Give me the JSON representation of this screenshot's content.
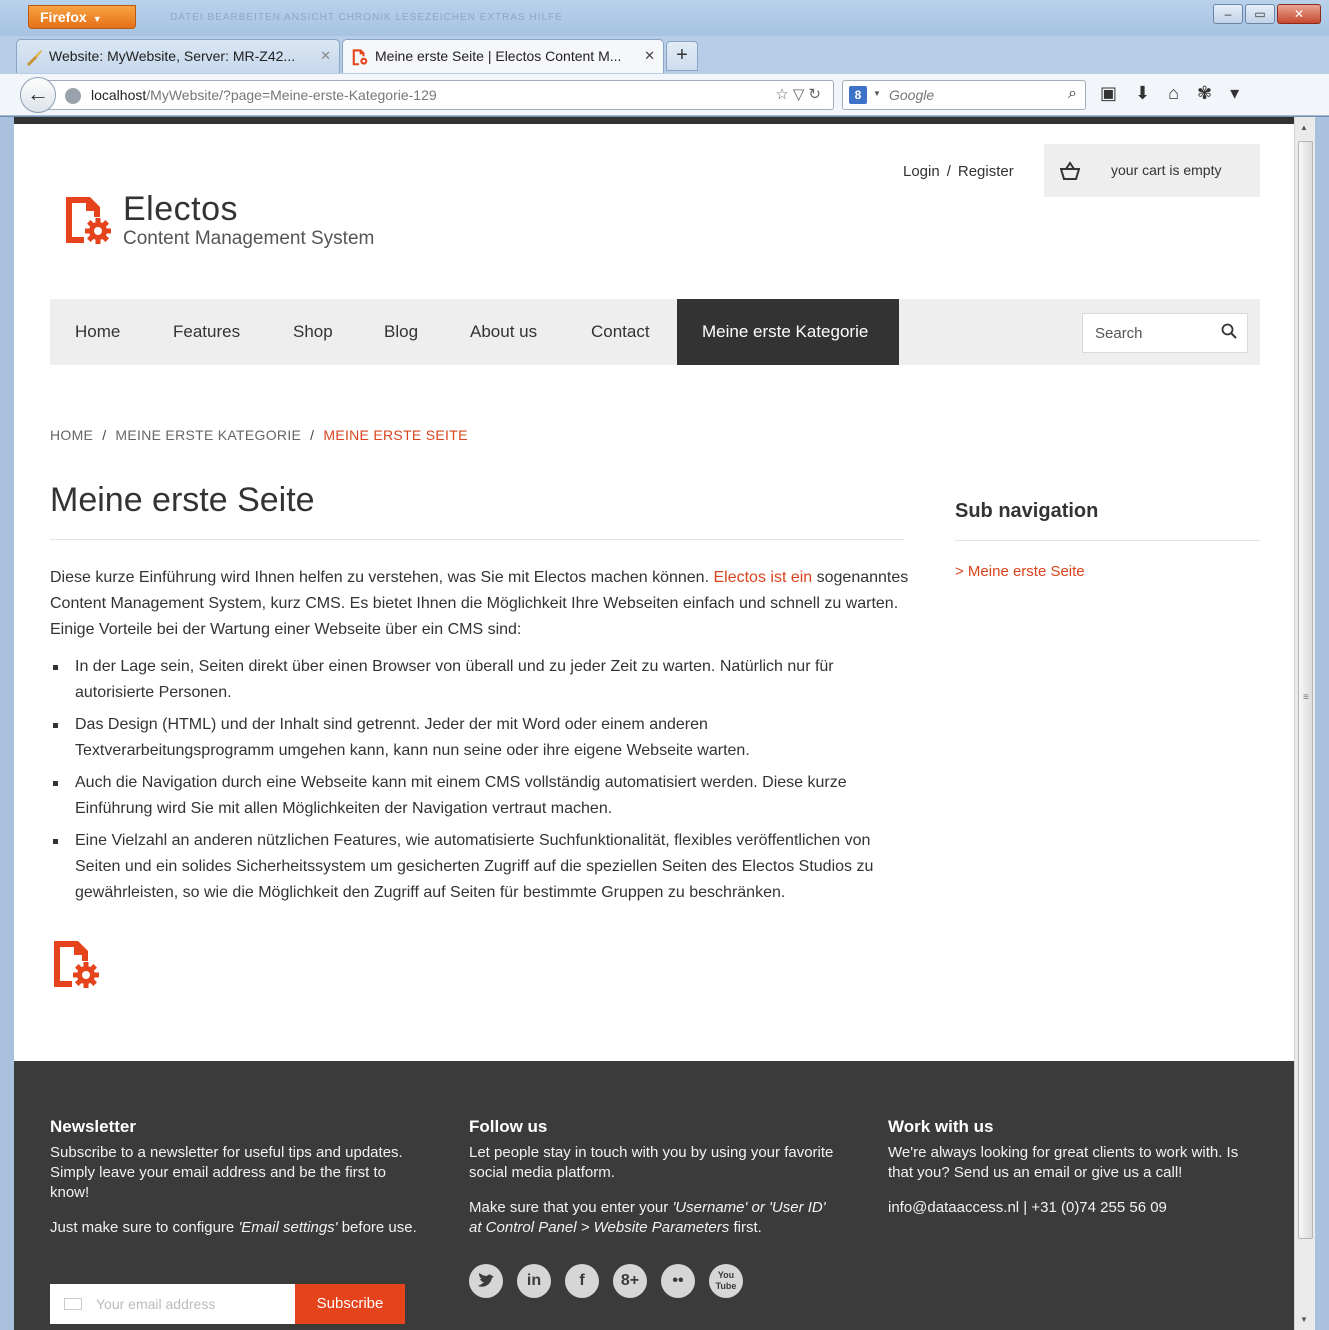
{
  "browser": {
    "app_button": "Firefox",
    "ghost_menu": "DATEI   BEARBEITEN   ANSICHT   CHRONIK   LESEZEICHEN   EXTRAS   HILFE",
    "tabs": [
      {
        "title": "Website: MyWebsite, Server: MR-Z42...",
        "active": false
      },
      {
        "title": "Meine erste Seite | Electos Content M...",
        "active": true
      }
    ],
    "url_host": "localhost",
    "url_path": "/MyWebsite/?page=Meine-erste-Kategorie-129",
    "search_placeholder": "Google"
  },
  "header": {
    "login": "Login",
    "separator": "/",
    "register": "Register",
    "cart_text": "your cart is empty",
    "logo_title": "Electos",
    "logo_subtitle": "Content Management System"
  },
  "nav": {
    "items": [
      "Home",
      "Features",
      "Shop",
      "Blog",
      "About us",
      "Contact",
      "Meine erste Kategorie"
    ],
    "active_index": 6,
    "search_placeholder": "Search"
  },
  "breadcrumb": [
    "HOME",
    "MEINE ERSTE KATEGORIE",
    "MEINE ERSTE SEITE"
  ],
  "content": {
    "title": "Meine erste Seite",
    "intro_before": "Diese kurze Einführung wird Ihnen helfen zu verstehen, was Sie mit Electos machen können. ",
    "intro_link": "Electos ist ein",
    "intro_after": " sogenanntes Content Management System, kurz CMS. Es bietet Ihnen die Möglichkeit Ihre Webseiten einfach und schnell zu warten. Einige Vorteile bei der Wartung einer Webseite über ein CMS sind:",
    "bullets": [
      "In der Lage sein, Seiten direkt über einen Browser von überall und zu jeder Zeit zu warten. Natürlich nur für autorisierte Personen.",
      "Das Design (HTML) und der Inhalt sind getrennt. Jeder der mit Word oder einem anderen Textverarbeitungsprogramm umgehen kann, kann nun seine oder ihre eigene Webseite warten.",
      "Auch die Navigation durch eine Webseite kann mit einem CMS vollständig automatisiert werden. Diese kurze Einführung wird Sie mit allen Möglichkeiten der Navigation vertraut machen.",
      "Eine Vielzahl an anderen nützlichen Features, wie automatisierte Suchfunktionalität, flexibles veröffentlichen von Seiten und ein solides Sicherheitssystem um gesicherten Zugriff auf die speziellen Seiten des Electos Studios zu gewährleisten, so wie die Möglichkeit den Zugriff auf Seiten für bestimmte Gruppen zu beschränken."
    ]
  },
  "sidebar": {
    "title": "Sub navigation",
    "link": "> Meine erste Seite"
  },
  "footer": {
    "newsletter_title": "Newsletter",
    "newsletter_text": "Subscribe to a newsletter for useful tips and updates. Simply leave your email address and be the first to know!",
    "newsletter_note_before": "Just make sure to configure ",
    "newsletter_note_em": "'Email settings'",
    "newsletter_note_after": " before use.",
    "email_placeholder": "Your email address",
    "subscribe_label": "Subscribe",
    "follow_title": "Follow us",
    "follow_text": "Let people stay in touch with you by using your favorite social media platform.",
    "follow_note_before": "Make sure that you enter your ",
    "follow_note_em": "'Username' or 'User ID' at Control Panel > Website Parameters",
    "follow_note_after": " first.",
    "social": [
      "twitter",
      "in",
      "f",
      "8+",
      "••",
      "You Tube"
    ],
    "work_title": "Work with us",
    "work_text": "We're always looking for great clients to work with. Is that you? Send us an email or give us a call!",
    "work_contact": "info@dataaccess.nl | +31 (0)74 255 56 09"
  },
  "colors": {
    "accent": "#d9441d",
    "dark": "#333333",
    "footer": "#3b3b3b",
    "subscribe": "#e4431b"
  }
}
